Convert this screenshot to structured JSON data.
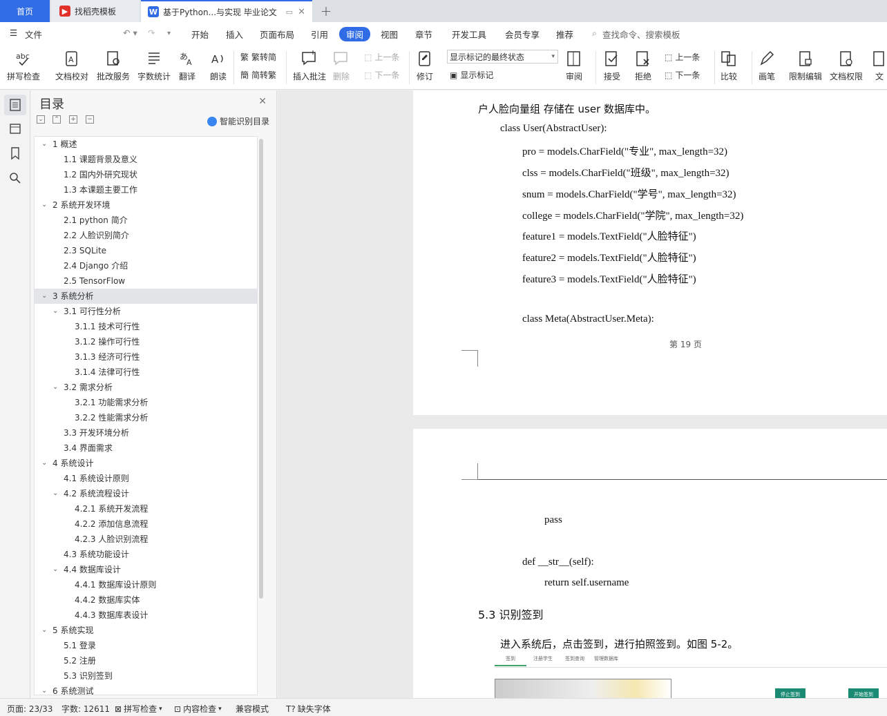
{
  "tabs": {
    "home": "首页",
    "wps_template": "找稻壳模板",
    "document": "基于Python...与实现 毕业论文"
  },
  "menu": [
    "文件",
    "开始",
    "插入",
    "页面布局",
    "引用",
    "审阅",
    "视图",
    "章节",
    "开发工具",
    "会员专享",
    "推荐"
  ],
  "menu_search": "查找命令、搜索模板",
  "ribbon": {
    "spell_check": "拼写检查",
    "doc_proof": "文档校对",
    "revise_service": "批改服务",
    "word_count": "字数统计",
    "translate": "翻译",
    "read_aloud": "朗读",
    "trad_to_simp": "繁转简",
    "simp_to_trad": "简转繁",
    "insert_comment": "插入批注",
    "delete": "删除",
    "prev_item": "上一条",
    "next_item": "下一条",
    "revise": "修订",
    "markup_state": "显示标记的最终状态",
    "show_markup": "显示标记",
    "review": "审阅",
    "accept": "接受",
    "reject": "拒绝",
    "prev_change": "上一条",
    "next_change": "下一条",
    "compare": "比较",
    "pen": "画笔",
    "restrict_edit": "限制编辑",
    "doc_permission": "文档权限",
    "doc_cut": "文"
  },
  "toc": {
    "title": "目录",
    "smart_label": "智能识别目录",
    "items": [
      {
        "text": "1  概述",
        "level": 0,
        "chev": true
      },
      {
        "text": "1.1 课题背景及意义",
        "level": 1
      },
      {
        "text": "1.2  国内外研究现状",
        "level": 1
      },
      {
        "text": "1.3  本课题主要工作",
        "level": 1
      },
      {
        "text": "2  系统开发环境",
        "level": 0,
        "chev": true
      },
      {
        "text": "2.1 python 简介",
        "level": 1
      },
      {
        "text": "2.2  人脸识别简介",
        "level": 1
      },
      {
        "text": "2.3 SQLite",
        "level": 1
      },
      {
        "text": "2.4 Django 介绍",
        "level": 1
      },
      {
        "text": "2.5 TensorFlow",
        "level": 1
      },
      {
        "text": "3  系统分析",
        "level": 0,
        "chev": true,
        "sel": true
      },
      {
        "text": "3.1  可行性分析",
        "level": 1,
        "chev": true
      },
      {
        "text": "3.1.1  技术可行性",
        "level": 2
      },
      {
        "text": "3.1.2 操作可行性",
        "level": 2
      },
      {
        "text": "3.1.3  经济可行性",
        "level": 2
      },
      {
        "text": "3.1.4  法律可行性",
        "level": 2
      },
      {
        "text": "3.2 需求分析",
        "level": 1,
        "chev": true
      },
      {
        "text": "3.2.1  功能需求分析",
        "level": 2
      },
      {
        "text": "3.2.2  性能需求分析",
        "level": 2
      },
      {
        "text": "3.3 开发环境分析",
        "level": 1
      },
      {
        "text": "3.4 界面需求",
        "level": 1
      },
      {
        "text": "4  系统设计",
        "level": 0,
        "chev": true
      },
      {
        "text": "4.1 系统设计原则",
        "level": 1
      },
      {
        "text": "4.2 系统流程设计",
        "level": 1,
        "chev": true
      },
      {
        "text": "4.2.1 系统开发流程",
        "level": 2
      },
      {
        "text": "4.2.2  添加信息流程",
        "level": 2
      },
      {
        "text": "4.2.3  人脸识别流程",
        "level": 2
      },
      {
        "text": "4.3  系统功能设计",
        "level": 1
      },
      {
        "text": "4.4  数据库设计",
        "level": 1,
        "chev": true
      },
      {
        "text": "4.4.1  数据库设计原则",
        "level": 2
      },
      {
        "text": "4.4.2  数据库实体",
        "level": 2
      },
      {
        "text": "4.4.3  数据库表设计",
        "level": 2
      },
      {
        "text": "5 系统实现",
        "level": 0,
        "chev": true
      },
      {
        "text": "5.1  登录",
        "level": 1
      },
      {
        "text": "5.2  注册",
        "level": 1
      },
      {
        "text": "5.3  识别签到",
        "level": 1
      },
      {
        "text": "6 系统测试",
        "level": 0,
        "chev": true
      }
    ]
  },
  "doc": {
    "page1_lines": [
      {
        "text": "户人脸向量组 存储在 user 数据库中。",
        "indent": 0,
        "cn": true
      },
      {
        "text": "class User(AbstractUser):",
        "indent": 1
      },
      {
        "text": "pro = models.CharField(\"专业\", max_length=32)",
        "indent": 2
      },
      {
        "text": "clss = models.CharField(\"班级\", max_length=32)",
        "indent": 2
      },
      {
        "text": "snum = models.CharField(\"学号\", max_length=32)",
        "indent": 2
      },
      {
        "text": "college = models.CharField(\"学院\", max_length=32)",
        "indent": 2
      },
      {
        "text": "feature1 = models.TextField(\"人脸特征\")",
        "indent": 2
      },
      {
        "text": "feature2 = models.TextField(\"人脸特征\")",
        "indent": 2
      },
      {
        "text": "feature3 = models.TextField(\"人脸特征\")",
        "indent": 2
      },
      {
        "text": "",
        "indent": 2
      },
      {
        "text": "class Meta(AbstractUser.Meta):",
        "indent": 2
      }
    ],
    "page_number": "第  19  页",
    "page2_pass": "pass",
    "page2_def": "def __str__(self):",
    "page2_return": "return self.username",
    "heading": "5.3  识别签到",
    "paragraph": "进入系统后，点击签到，进行拍照签到。如图 5-2。",
    "figure_tabs": [
      "签到",
      "注册学生",
      "签到查询",
      "管理数据库"
    ],
    "figure_buttons": [
      "停止签到",
      "开始签到"
    ]
  },
  "status": {
    "page": "页面: 23/33",
    "words": "字数: 12611",
    "spell": "拼写检查",
    "content": "内容检查",
    "compat": "兼容模式",
    "missing_font": "缺失字体"
  }
}
